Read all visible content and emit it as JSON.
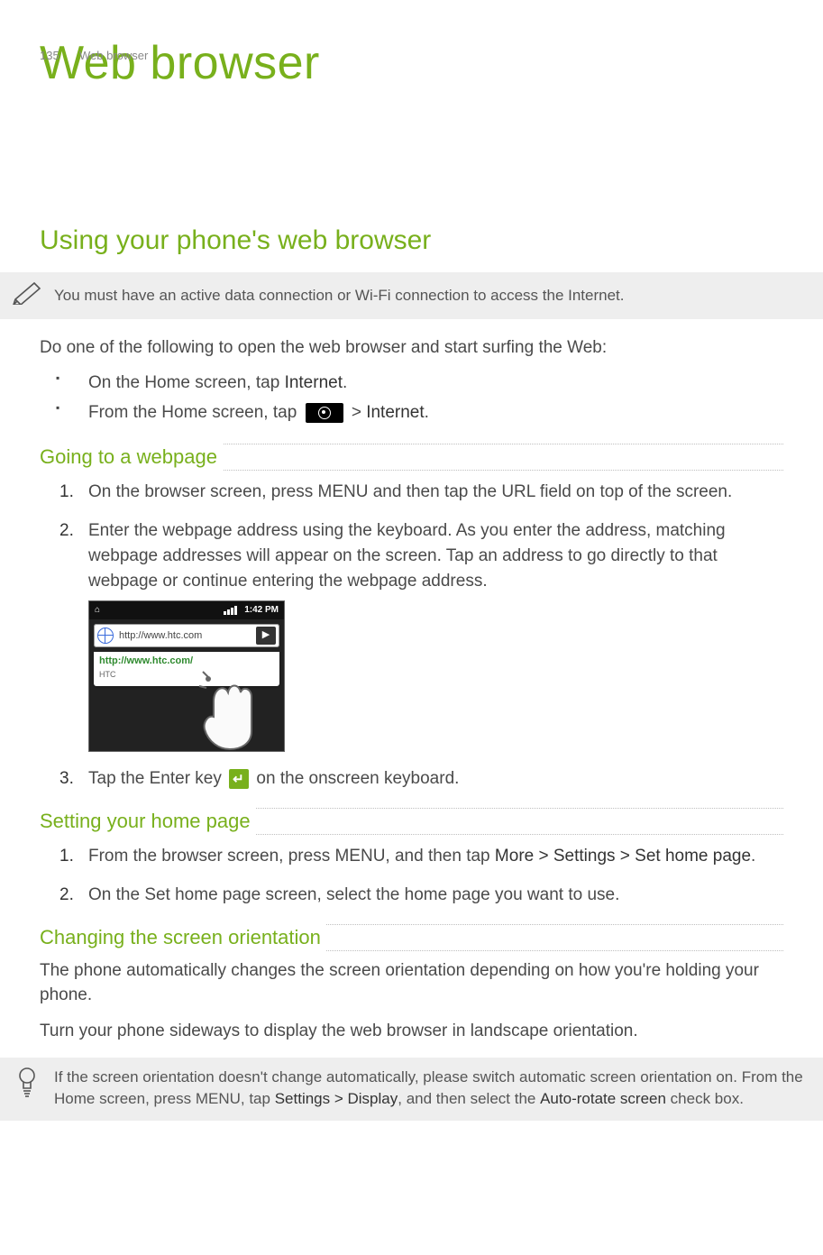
{
  "header": {
    "page_number": "135",
    "running_title": "Web browser"
  },
  "h1": "Web browser",
  "h2": "Using your phone's web browser",
  "note1": "You must have an active data connection or Wi-Fi connection to access the Internet.",
  "intro": "Do one of the following to open the web browser and start surfing the Web:",
  "bullets": {
    "b1_pre": "On the Home screen, tap ",
    "b1_strong": "Internet",
    "b1_post": ".",
    "b2_pre": "From the Home screen, tap ",
    "b2_mid": " > ",
    "b2_strong": "Internet",
    "b2_post": "."
  },
  "sec1": {
    "title": "Going to a webpage",
    "step1": "On the browser screen, press MENU and then tap the URL field on top of the screen.",
    "step2": "Enter the webpage address using the keyboard. As you enter the address, matching webpage addresses will appear on the screen. Tap an address to go directly to that webpage or continue entering the webpage address.",
    "step3_pre": "Tap the Enter key ",
    "step3_post": " on the onscreen keyboard.",
    "screenshot": {
      "status_time": "1:42 PM",
      "url_value": "http://www.htc.com",
      "go_label": "▶",
      "suggest_title": "http://www.htc.com/",
      "suggest_sub": "HTC"
    }
  },
  "sec2": {
    "title": "Setting your home page",
    "step1_pre": "From the browser screen, press MENU, and then tap ",
    "step1_strong": "More > Settings > Set home page",
    "step1_post": ".",
    "step2": "On the Set home page screen, select the home page you want to use."
  },
  "sec3": {
    "title": "Changing the screen orientation",
    "p1": "The phone automatically changes the screen orientation depending on how you're holding your phone.",
    "p2": "Turn your phone sideways to display the web browser in landscape orientation."
  },
  "tip": {
    "pre": "If the screen orientation doesn't change automatically, please switch automatic screen orientation on. From the Home screen, press MENU, tap ",
    "strong1": "Settings > Display",
    "mid": ", and then select the ",
    "strong2": "Auto-rotate screen",
    "post": " check box."
  }
}
